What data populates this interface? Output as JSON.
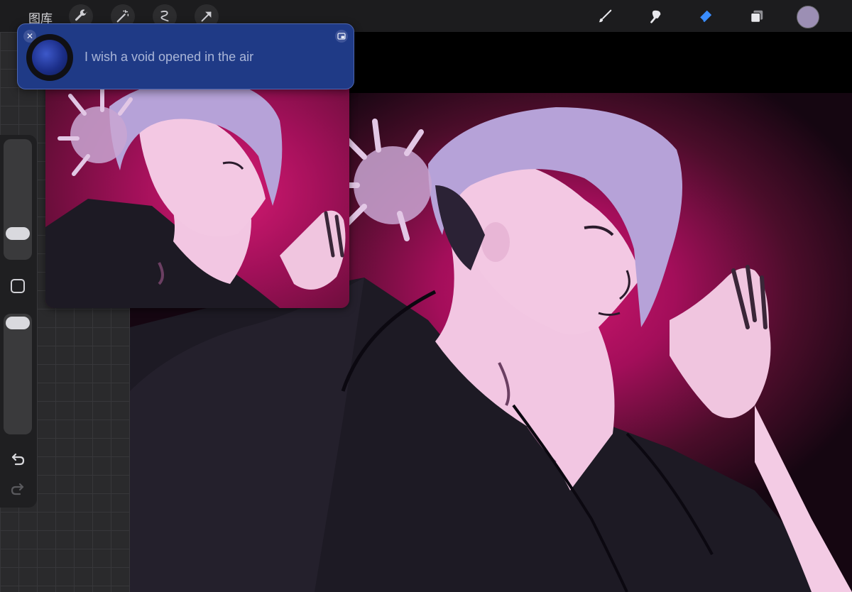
{
  "toolbar": {
    "gallery_label": "图库",
    "left_tools": [
      "wrench-icon",
      "magic-wand-icon",
      "selection-icon",
      "transform-arrow-icon"
    ],
    "right_tools": [
      "brush-icon",
      "smudge-icon",
      "eraser-icon",
      "layers-icon"
    ],
    "active_tool": "eraser-icon",
    "active_tool_color": "#3a8dff",
    "current_color": "#9c8fb4"
  },
  "notification": {
    "message": "I wish a void opened in the air",
    "background": "#1f3a86"
  },
  "sidebar": {
    "brush_size_level": 0.75,
    "opacity_level": 0.0,
    "buttons": [
      "modifier-square-icon",
      "undo-icon",
      "redo-icon"
    ]
  },
  "reference_window": {
    "description_icon": "reference-image"
  },
  "colors": {
    "canvas_magenta": "#d0176f",
    "hair_lavender": "#b7a3d6",
    "skin_pink": "#f0c7e0",
    "shirt_dark": "#1d1a24"
  }
}
